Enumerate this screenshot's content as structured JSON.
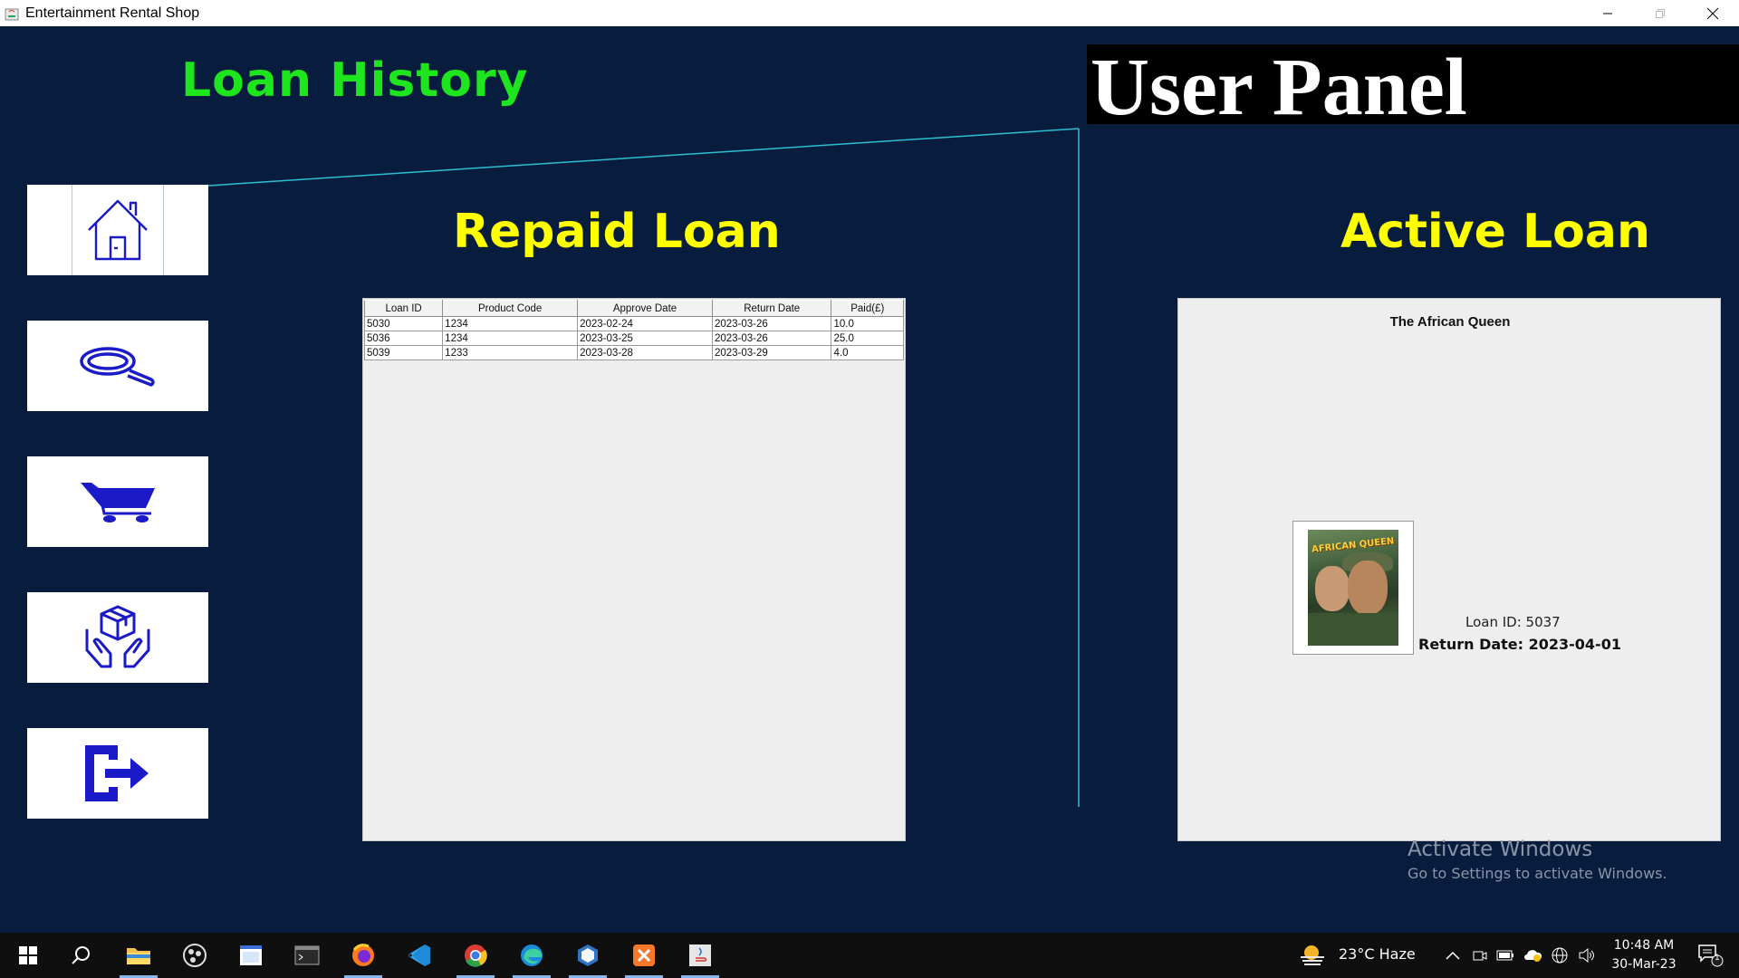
{
  "window": {
    "title": "Entertainment Rental Shop",
    "controls": [
      "minimize",
      "maximize",
      "close"
    ]
  },
  "header": {
    "loan_history_title": "Loan History",
    "user_panel_title": "User Panel"
  },
  "sidebar": {
    "items": [
      {
        "name": "home",
        "icon": "home-icon"
      },
      {
        "name": "search",
        "icon": "search-icon"
      },
      {
        "name": "cart",
        "icon": "cart-icon"
      },
      {
        "name": "deliver",
        "icon": "hands-package-icon"
      },
      {
        "name": "logout",
        "icon": "logout-icon"
      }
    ]
  },
  "repaid_loan": {
    "title": "Repaid Loan",
    "columns": [
      "Loan ID",
      "Product Code",
      "Approve Date",
      "Return Date",
      "Paid(£)"
    ],
    "rows": [
      [
        "5030",
        "1234",
        "2023-02-24",
        "2023-03-26",
        "10.0"
      ],
      [
        "5036",
        "1234",
        "2023-03-25",
        "2023-03-26",
        "25.0"
      ],
      [
        "5039",
        "1233",
        "2023-03-28",
        "2023-03-29",
        "4.0"
      ]
    ]
  },
  "active_loan": {
    "title": "Active Loan",
    "movie_title": "The African Queen",
    "poster_text": "AFRICAN QUEEN",
    "loan_id_text": "Loan ID: 5037",
    "return_date_text": "Return Date: 2023-04-01"
  },
  "watermark": {
    "line1": "Activate Windows",
    "line2": "Go to Settings to activate Windows."
  },
  "taskbar": {
    "weather": "23°C  Haze",
    "time": "10:48 AM",
    "date": "30-Mar-23",
    "notification_count": "1",
    "apps": [
      "start-icon",
      "search-icon",
      "file-explorer-icon",
      "obs-icon",
      "notepad-icon",
      "terminal-icon",
      "firefox-icon",
      "vscode-icon",
      "chrome-icon",
      "edge-icon",
      "virtualbox-icon",
      "xampp-icon",
      "java-icon"
    ]
  },
  "colors": {
    "background": "#081d3d",
    "loan_history_green": "#1ee51e",
    "section_yellow": "#ffff00",
    "icon_blue": "#1a1ac8",
    "line_cyan": "#2bbfd0"
  }
}
